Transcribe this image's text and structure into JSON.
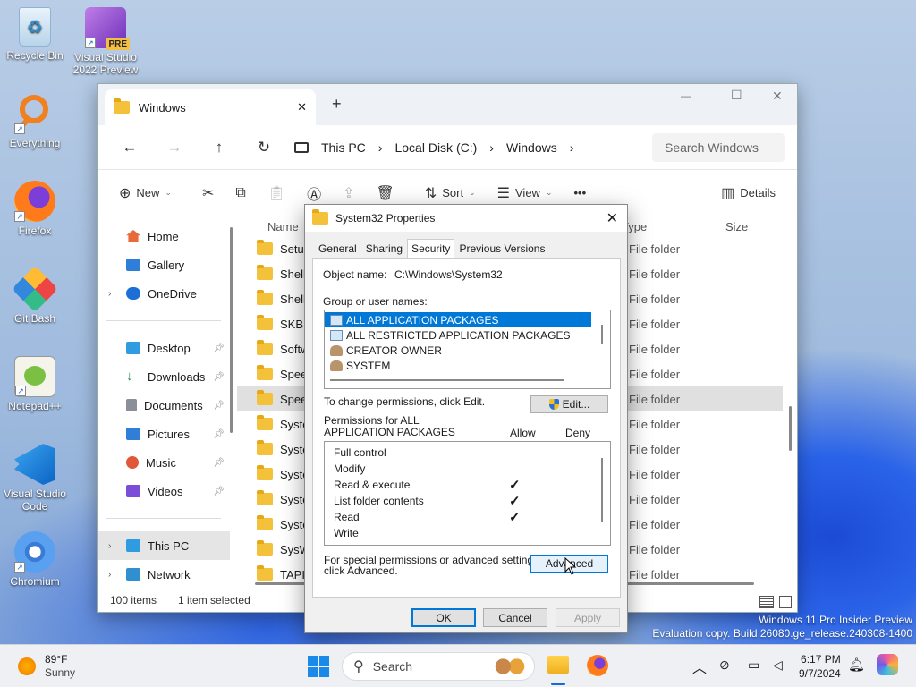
{
  "desktop": {
    "icons": [
      {
        "label": "Recycle Bin",
        "icon": "recycle-bin-icon"
      },
      {
        "label": "Visual Studio 2022 Preview",
        "icon": "visual-studio-preview-icon",
        "badge": "PRE"
      },
      {
        "label": "Everything",
        "icon": "everything-search-icon"
      },
      {
        "label": "Firefox",
        "icon": "firefox-icon"
      },
      {
        "label": "Git Bash",
        "icon": "git-bash-icon"
      },
      {
        "label": "Notepad++",
        "icon": "notepadpp-icon"
      },
      {
        "label": "Visual Studio Code",
        "icon": "vscode-icon"
      },
      {
        "label": "Chromium",
        "icon": "chromium-icon"
      }
    ]
  },
  "explorer": {
    "tab_title": "Windows",
    "new_tab": "+",
    "window_controls": {
      "minimize": "—",
      "maximize": "☐",
      "close": "✕"
    },
    "breadcrumb": [
      "This PC",
      "Local Disk (C:)",
      "Windows"
    ],
    "search_placeholder": "Search Windows",
    "toolbar": {
      "new": "New",
      "sort": "Sort",
      "view": "View",
      "more": "•••",
      "details": "Details"
    },
    "sidebar": {
      "top": [
        {
          "label": "Home",
          "color": "#e86a3a"
        },
        {
          "label": "Gallery",
          "color": "#2f7ed8"
        },
        {
          "label": "OneDrive",
          "color": "#1c6fd6",
          "expandable": true
        }
      ],
      "pinned": [
        {
          "label": "Desktop",
          "color": "#2f9be0"
        },
        {
          "label": "Downloads",
          "color": "#2e8b57"
        },
        {
          "label": "Documents",
          "color": "#8a8f99"
        },
        {
          "label": "Pictures",
          "color": "#2f7ed8"
        },
        {
          "label": "Music",
          "color": "#e0573a"
        },
        {
          "label": "Videos",
          "color": "#7b4ed8"
        }
      ],
      "bottom": [
        {
          "label": "This PC",
          "color": "#2f9be0",
          "selected": true
        },
        {
          "label": "Network",
          "color": "#2f8fd0"
        }
      ]
    },
    "columns": {
      "name": "Name",
      "type": "Type",
      "size": "Size"
    },
    "files": [
      {
        "name": "Setup",
        "type": "File folder"
      },
      {
        "name": "ShellC",
        "type": "File folder"
      },
      {
        "name": "ShellEx",
        "type": "File folder"
      },
      {
        "name": "SKB",
        "type": "File folder"
      },
      {
        "name": "Softwa",
        "type": "File folder"
      },
      {
        "name": "Speech",
        "type": "File folder"
      },
      {
        "name": "Speech",
        "type": "File folder",
        "selected": true
      },
      {
        "name": "System",
        "type": "File folder"
      },
      {
        "name": "System",
        "type": "File folder"
      },
      {
        "name": "System",
        "type": "File folder"
      },
      {
        "name": "System",
        "type": "File folder"
      },
      {
        "name": "System",
        "type": "File folder"
      },
      {
        "name": "SysWO",
        "type": "File folder"
      },
      {
        "name": "TAPI",
        "type": "File folder"
      }
    ],
    "status": {
      "count": "100 items",
      "selected": "1 item selected"
    }
  },
  "dialog": {
    "title": "System32 Properties",
    "tabs": [
      "General",
      "Sharing",
      "Security",
      "Previous Versions"
    ],
    "active_tab": "Security",
    "object_name_label": "Object name:",
    "object_name_value": "C:\\Windows\\System32",
    "group_label": "Group or user names:",
    "groups": [
      {
        "name": "ALL APPLICATION PACKAGES",
        "icon": "group-icon",
        "selected": true
      },
      {
        "name": "ALL RESTRICTED APPLICATION PACKAGES",
        "icon": "group-icon"
      },
      {
        "name": "CREATOR OWNER",
        "icon": "user-icon"
      },
      {
        "name": "SYSTEM",
        "icon": "user-icon"
      }
    ],
    "change_text": "To change permissions, click Edit.",
    "edit_button": "Edit...",
    "perm_label_1": "Permissions for ALL",
    "perm_label_2": "APPLICATION PACKAGES",
    "allow": "Allow",
    "deny": "Deny",
    "permissions": [
      {
        "name": "Full control",
        "allow": false
      },
      {
        "name": "Modify",
        "allow": false
      },
      {
        "name": "Read & execute",
        "allow": true
      },
      {
        "name": "List folder contents",
        "allow": true
      },
      {
        "name": "Read",
        "allow": true
      },
      {
        "name": "Write",
        "allow": false
      }
    ],
    "special_text_1": "For special permissions or advanced settings,",
    "special_text_2": "click Advanced.",
    "advanced_button": "Advanced",
    "ok": "OK",
    "cancel": "Cancel",
    "apply": "Apply"
  },
  "watermark": {
    "line1": "Windows 11 Pro Insider Preview",
    "line2": "Evaluation copy. Build 26080.ge_release.240308-1400"
  },
  "taskbar": {
    "weather_temp": "89°F",
    "weather_desc": "Sunny",
    "search_placeholder": "Search",
    "time": "6:17 PM",
    "date": "9/7/2024"
  }
}
